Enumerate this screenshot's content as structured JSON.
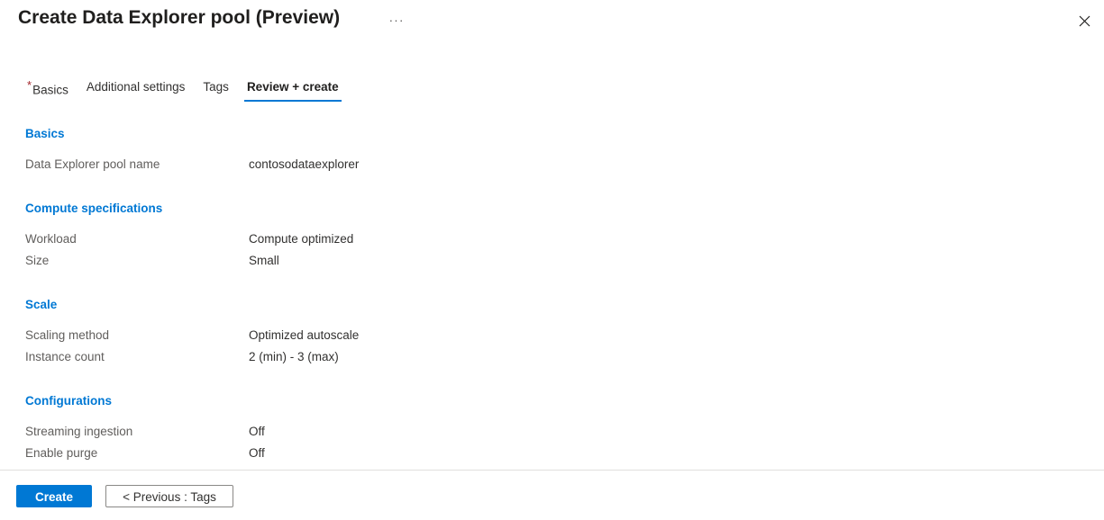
{
  "header": {
    "title": "Create Data Explorer pool (Preview)",
    "more_label": "···",
    "close_icon": "close-icon"
  },
  "tabs": [
    {
      "label": "Basics",
      "required": true,
      "required_marker": "*",
      "active": false
    },
    {
      "label": "Additional settings",
      "required": false,
      "required_marker": "",
      "active": false
    },
    {
      "label": "Tags",
      "required": false,
      "required_marker": "",
      "active": false
    },
    {
      "label": "Review + create",
      "required": false,
      "required_marker": "",
      "active": true
    }
  ],
  "sections": [
    {
      "heading": "Basics",
      "rows": [
        {
          "label": "Data Explorer pool name",
          "value": "contosodataexplorer"
        }
      ]
    },
    {
      "heading": "Compute specifications",
      "rows": [
        {
          "label": "Workload",
          "value": "Compute optimized"
        },
        {
          "label": "Size",
          "value": "Small"
        }
      ]
    },
    {
      "heading": "Scale",
      "rows": [
        {
          "label": "Scaling method",
          "value": "Optimized autoscale"
        },
        {
          "label": "Instance count",
          "value": "2 (min) - 3 (max)"
        }
      ]
    },
    {
      "heading": "Configurations",
      "rows": [
        {
          "label": "Streaming ingestion",
          "value": "Off"
        },
        {
          "label": "Enable purge",
          "value": "Off"
        }
      ]
    }
  ],
  "footer": {
    "create_label": "Create",
    "previous_label": "< Previous : Tags"
  },
  "colors": {
    "accent": "#0078d4",
    "heading": "#0078d4",
    "required": "#a4262c",
    "label": "#605e5c",
    "value": "#323130",
    "divider": "#e1dfdd",
    "button_border": "#8a8886"
  }
}
